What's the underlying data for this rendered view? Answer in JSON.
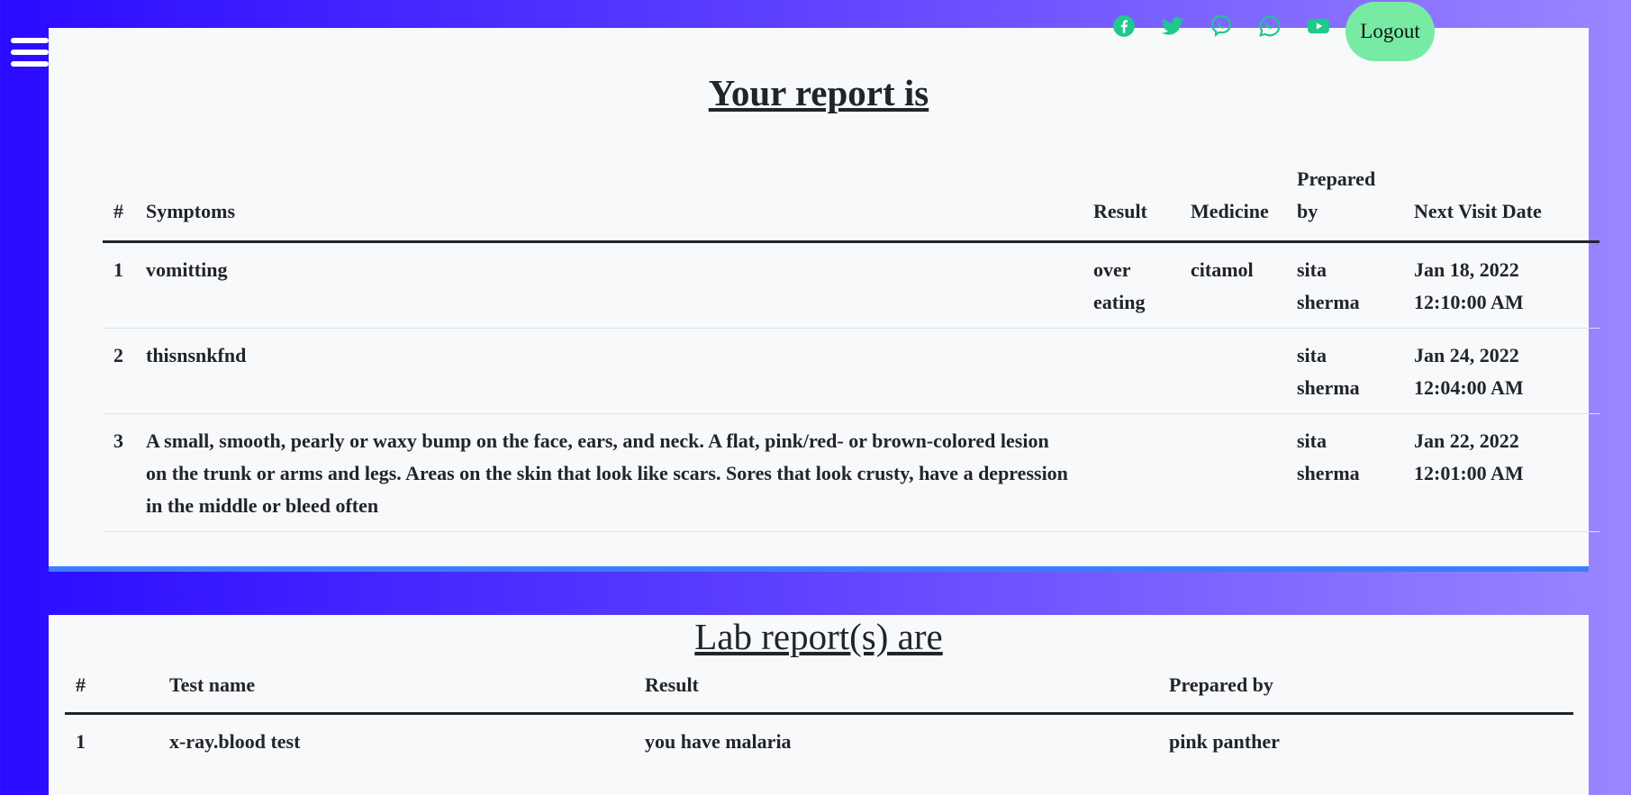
{
  "nav": {
    "logout_label": "Logout"
  },
  "social": [
    {
      "icon": "facebook-icon"
    },
    {
      "icon": "twitter-icon"
    },
    {
      "icon": "viber-icon"
    },
    {
      "icon": "whatsapp-icon"
    },
    {
      "icon": "youtube-icon"
    }
  ],
  "colors": {
    "social_icon": "#1ec98a",
    "logout_bg": "#77eba4",
    "card_border": "#3b7bff"
  },
  "report": {
    "title": "Your report is",
    "columns": [
      "#",
      "Symptoms",
      "Result",
      "Medicine",
      "Prepared by",
      "Next Visit Date"
    ],
    "rows": [
      {
        "num": "1",
        "symptoms": "vomitting",
        "result": "over eating",
        "medicine": "citamol",
        "prepared_by": "sita sherma",
        "next_visit": "Jan 18, 2022 12:10:00 AM"
      },
      {
        "num": "2",
        "symptoms": "thisnsnkfnd",
        "result": "",
        "medicine": "",
        "prepared_by": "sita sherma",
        "next_visit": "Jan 24, 2022 12:04:00 AM"
      },
      {
        "num": "3",
        "symptoms": "A small, smooth, pearly or waxy bump on the face, ears, and neck. A flat, pink/red- or brown-colored lesion on the trunk or arms and legs. Areas on the skin that look like scars. Sores that look crusty, have a depression in the middle or bleed often",
        "result": "",
        "medicine": "",
        "prepared_by": "sita sherma",
        "next_visit": "Jan 22, 2022 12:01:00 AM"
      }
    ]
  },
  "lab": {
    "title": "Lab report(s) are",
    "columns": [
      "#",
      "Test name",
      "Result",
      "Prepared by"
    ],
    "rows": [
      {
        "num": "1",
        "test_name": "x-ray.blood test",
        "result": "you have malaria",
        "prepared_by": "pink panther"
      }
    ]
  }
}
